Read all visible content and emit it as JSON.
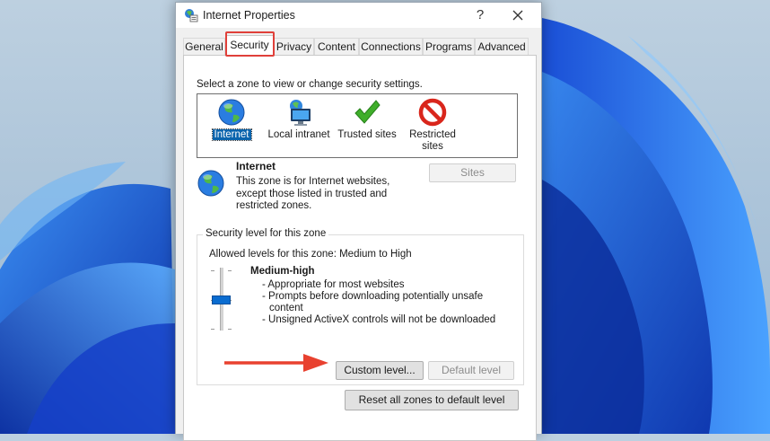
{
  "window": {
    "title": "Internet Properties",
    "help_glyph": "?",
    "close_icon": "close-icon",
    "app_icon": "internet-options-icon"
  },
  "tabs": [
    {
      "label": "General"
    },
    {
      "label": "Security",
      "active": true,
      "highlighted": true
    },
    {
      "label": "Privacy"
    },
    {
      "label": "Content"
    },
    {
      "label": "Connections"
    },
    {
      "label": "Programs"
    },
    {
      "label": "Advanced"
    }
  ],
  "security": {
    "instruction": "Select a zone to view or change security settings.",
    "zones": [
      {
        "label": "Internet",
        "icon": "globe-icon",
        "selected": true
      },
      {
        "label": "Local intranet",
        "icon": "intranet-icon"
      },
      {
        "label": "Trusted sites",
        "icon": "checkmark-icon"
      },
      {
        "label_line1": "Restricted",
        "label_line2": "sites",
        "icon": "restricted-icon"
      }
    ],
    "zone_info": {
      "title": "Internet",
      "desc_line1": "This zone is for Internet websites,",
      "desc_line2": "except those listed in trusted and",
      "desc_line3": "restricted zones.",
      "icon": "globe-icon"
    },
    "sites_button": "Sites",
    "level_group": {
      "title": "Security level for this zone",
      "allowed": "Allowed levels for this zone: Medium to High",
      "level_name": "Medium-high",
      "bullets": [
        "- Appropriate for most websites",
        "- Prompts before downloading potentially unsafe",
        "content",
        "- Unsigned ActiveX controls will not be downloaded"
      ],
      "slider_level_fraction": 0.5,
      "custom_level_button": "Custom level...",
      "default_level_button": "Default level"
    },
    "reset_button": "Reset all zones to default level"
  },
  "annotations": {
    "arrow_color": "#e8412f",
    "highlight_color": "#e0403a"
  }
}
